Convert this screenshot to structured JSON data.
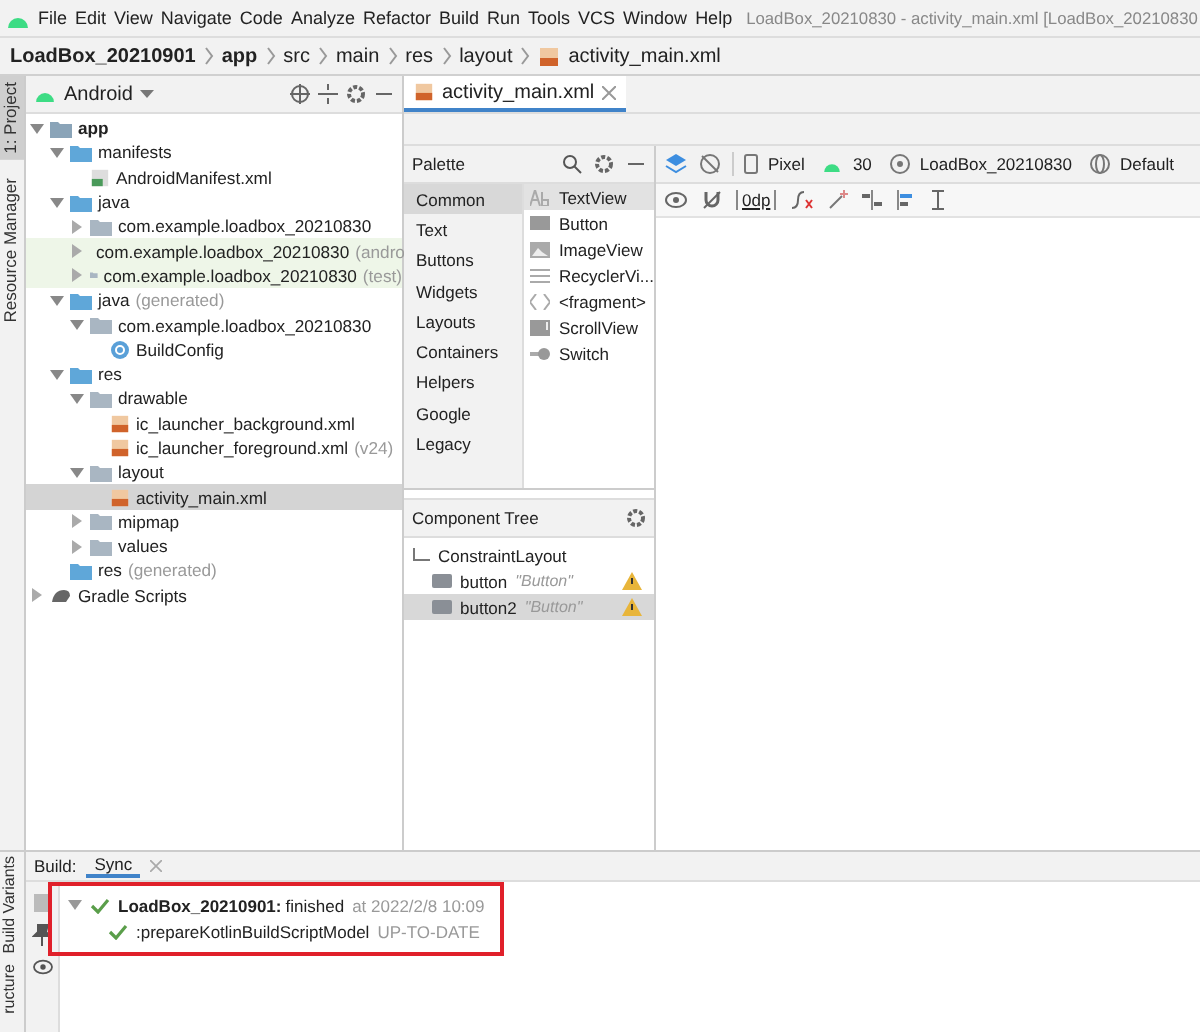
{
  "menu_bar": {
    "items": [
      "File",
      "Edit",
      "View",
      "Navigate",
      "Code",
      "Analyze",
      "Refactor",
      "Build",
      "Run",
      "Tools",
      "VCS",
      "Window",
      "Help"
    ],
    "title": "LoadBox_20210830 - activity_main.xml [LoadBox_20210830"
  },
  "breadcrumb": [
    {
      "label": "LoadBox_20210901",
      "kind": "project"
    },
    {
      "label": "app",
      "kind": "module"
    },
    {
      "label": "src",
      "kind": "folder"
    },
    {
      "label": "main",
      "kind": "folder"
    },
    {
      "label": "res",
      "kind": "folder"
    },
    {
      "label": "layout",
      "kind": "folder"
    },
    {
      "label": "activity_main.xml",
      "kind": "xml"
    }
  ],
  "left_stripe": [
    {
      "label": "1: Project",
      "selected": true
    },
    {
      "label": "Resource Manager",
      "selected": false
    }
  ],
  "project_panel": {
    "view": "Android",
    "tree": [
      {
        "label": "app",
        "kind": "module",
        "expanded": true,
        "selected": false,
        "children": [
          {
            "label": "manifests",
            "kind": "folder",
            "expanded": true,
            "selected": false,
            "children": [
              {
                "label": "AndroidManifest.xml",
                "kind": "manifest",
                "selected": false
              }
            ]
          },
          {
            "label": "java",
            "kind": "folder",
            "expanded": true,
            "selected": false,
            "children": [
              {
                "label": "com.example.loadbox_20210830",
                "kind": "package",
                "expanded": false,
                "selected": false,
                "tinted": false
              },
              {
                "label": "com.example.loadbox_20210830",
                "suffix": "(andro",
                "kind": "package",
                "expanded": false,
                "selected": false,
                "tinted": true
              },
              {
                "label": "com.example.loadbox_20210830",
                "suffix": "(test)",
                "kind": "package",
                "expanded": false,
                "selected": false,
                "tinted": true
              }
            ]
          },
          {
            "label": "java",
            "suffix": "(generated)",
            "kind": "folder",
            "expanded": true,
            "selected": false,
            "children": [
              {
                "label": "com.example.loadbox_20210830",
                "kind": "package",
                "expanded": true,
                "selected": false,
                "children": [
                  {
                    "label": "BuildConfig",
                    "kind": "class",
                    "selected": false
                  }
                ]
              }
            ]
          },
          {
            "label": "res",
            "kind": "folder",
            "expanded": true,
            "selected": false,
            "children": [
              {
                "label": "drawable",
                "kind": "package",
                "expanded": true,
                "selected": false,
                "children": [
                  {
                    "label": "ic_launcher_background.xml",
                    "kind": "xml",
                    "selected": false
                  },
                  {
                    "label": "ic_launcher_foreground.xml",
                    "suffix": "(v24)",
                    "kind": "xml",
                    "selected": false
                  }
                ]
              },
              {
                "label": "layout",
                "kind": "package",
                "expanded": true,
                "selected": false,
                "children": [
                  {
                    "label": "activity_main.xml",
                    "kind": "xml",
                    "selected": true
                  }
                ]
              },
              {
                "label": "mipmap",
                "kind": "package",
                "expanded": false,
                "selected": false
              },
              {
                "label": "values",
                "kind": "package",
                "expanded": false,
                "selected": false
              }
            ]
          },
          {
            "label": "res",
            "suffix": "(generated)",
            "kind": "folder",
            "selected": false
          }
        ]
      },
      {
        "label": "Gradle Scripts",
        "kind": "gradle",
        "expanded": false,
        "selected": false
      }
    ]
  },
  "editor_tabs": [
    {
      "label": "activity_main.xml",
      "selected": true
    }
  ],
  "palette": {
    "title": "Palette",
    "categories": [
      {
        "label": "Common",
        "selected": true
      },
      {
        "label": "Text",
        "selected": false
      },
      {
        "label": "Buttons",
        "selected": false
      },
      {
        "label": "Widgets",
        "selected": false
      },
      {
        "label": "Layouts",
        "selected": false
      },
      {
        "label": "Containers",
        "selected": false
      },
      {
        "label": "Helpers",
        "selected": false
      },
      {
        "label": "Google",
        "selected": false
      },
      {
        "label": "Legacy",
        "selected": false
      }
    ],
    "items": [
      {
        "label": "TextView",
        "kind": "text",
        "selected": true
      },
      {
        "label": "Button",
        "kind": "button",
        "selected": false
      },
      {
        "label": "ImageView",
        "kind": "image",
        "selected": false
      },
      {
        "label": "RecyclerVi...",
        "kind": "list",
        "selected": false
      },
      {
        "label": "<fragment>",
        "kind": "fragment",
        "selected": false
      },
      {
        "label": "ScrollView",
        "kind": "scroll",
        "selected": false
      },
      {
        "label": "Switch",
        "kind": "switch",
        "selected": false
      }
    ]
  },
  "design_toolbar": {
    "device": "Pixel",
    "api": "30",
    "theme": "LoadBox_20210830",
    "locale": "Default",
    "margin": "0dp"
  },
  "component_tree": {
    "title": "Component Tree",
    "root": "ConstraintLayout",
    "children": [
      {
        "id": "button",
        "text": "\"Button\"",
        "warning": true,
        "selected": false
      },
      {
        "id": "button2",
        "text": "\"Button\"",
        "warning": true,
        "selected": true
      }
    ]
  },
  "bottom_stripe": [
    "Build Variants",
    "ructure"
  ],
  "build_panel": {
    "label": "Build:",
    "tabs": [
      {
        "label": "Sync",
        "selected": true
      }
    ],
    "highlighted": true,
    "tree": [
      {
        "title": "LoadBox_20210901:",
        "status": "finished",
        "time": "at 2022/2/8 10:09",
        "expanded": true,
        "children": [
          {
            "title": ":prepareKotlinBuildScriptModel",
            "status": "UP-TO-DATE"
          }
        ]
      }
    ]
  }
}
